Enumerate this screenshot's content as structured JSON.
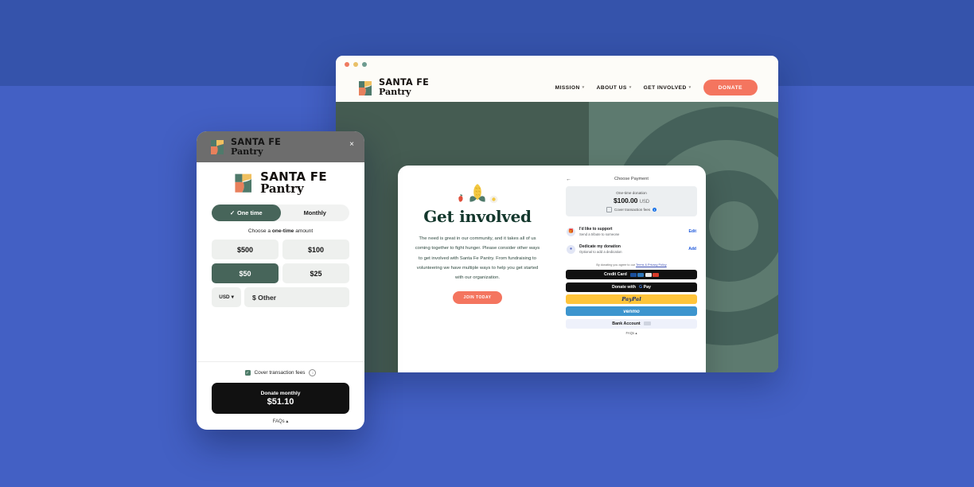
{
  "background": {
    "top_band_color": "#3553ab",
    "main_color": "#4360c4"
  },
  "browser": {
    "traffic_lights": [
      "red-dot",
      "yellow-dot",
      "green-dot"
    ],
    "brand": {
      "line1": "SANTA FE",
      "line2": "Pantry"
    },
    "nav": [
      {
        "label": "MISSION",
        "caret": "▾"
      },
      {
        "label": "ABOUT US",
        "caret": "▾"
      },
      {
        "label": "GET INVOLVED",
        "caret": "▾"
      }
    ],
    "donate_button": "DONATE"
  },
  "hero": {
    "veggies": [
      "chili-pepper-icon",
      "corn-icon",
      "egg-icon"
    ],
    "title": "Get involved",
    "body": "The need is great in our community, and it takes all of us coming together to fight hunger. Please consider other ways to get involved with Santa Fe Pantry. From fundraising to volunteering we have multiple ways to help you get started with our organization.",
    "cta": "JOIN TODAY"
  },
  "payment_panel": {
    "back_arrow": "←",
    "title": "Choose Payment",
    "amount_label": "One-time donation",
    "amount_value": "$100.00",
    "amount_currency": "USD",
    "cover_fees_label": "Cover transaction fees",
    "options": [
      {
        "icon": "gift-icon",
        "title": "I'd like to support",
        "subtitle": "Send a tribute to someone",
        "action": "Edit"
      },
      {
        "icon": "person-icon",
        "title": "Dedicate my donation",
        "subtitle": "Optional to add a dedication",
        "action": "Add"
      }
    ],
    "terms_prefix": "By donating you agree to our ",
    "terms_link": "Terms & Privacy Policy",
    "methods": [
      {
        "label": "Credit Card",
        "style": "dark",
        "cards": [
          "visa",
          "amex",
          "discover",
          "mastercard"
        ]
      },
      {
        "label": "Donate with",
        "style": "dark",
        "brand": "G Pay"
      },
      {
        "label": "PayPal",
        "style": "paypal"
      },
      {
        "label": "venmo",
        "style": "venmo"
      },
      {
        "label": "Bank Account",
        "style": "bank"
      }
    ],
    "faqs": "FAQs ▴"
  },
  "modal": {
    "header_brand": {
      "line1": "SANTA FE",
      "line2": "Pantry"
    },
    "close_icon": "×",
    "brand": {
      "line1": "SANTA FE",
      "line2": "Pantry"
    },
    "tabs": [
      {
        "label": "One time",
        "selected": true,
        "check": "✓"
      },
      {
        "label": "Monthly",
        "selected": false
      }
    ],
    "choose_prefix": "Choose a ",
    "choose_bold": "one-time",
    "choose_suffix": " amount",
    "amounts": [
      {
        "label": "$500",
        "selected": false
      },
      {
        "label": "$100",
        "selected": false
      },
      {
        "label": "$50",
        "selected": true
      },
      {
        "label": "$25",
        "selected": false
      }
    ],
    "currency": "USD",
    "currency_caret": "▾",
    "other_placeholder": "$ Other",
    "cover_fees_label": "Cover transaction fees",
    "info_icon": "i",
    "donate_label": "Donate monthly",
    "donate_amount": "$51.10",
    "faqs": "FAQs ▴"
  }
}
